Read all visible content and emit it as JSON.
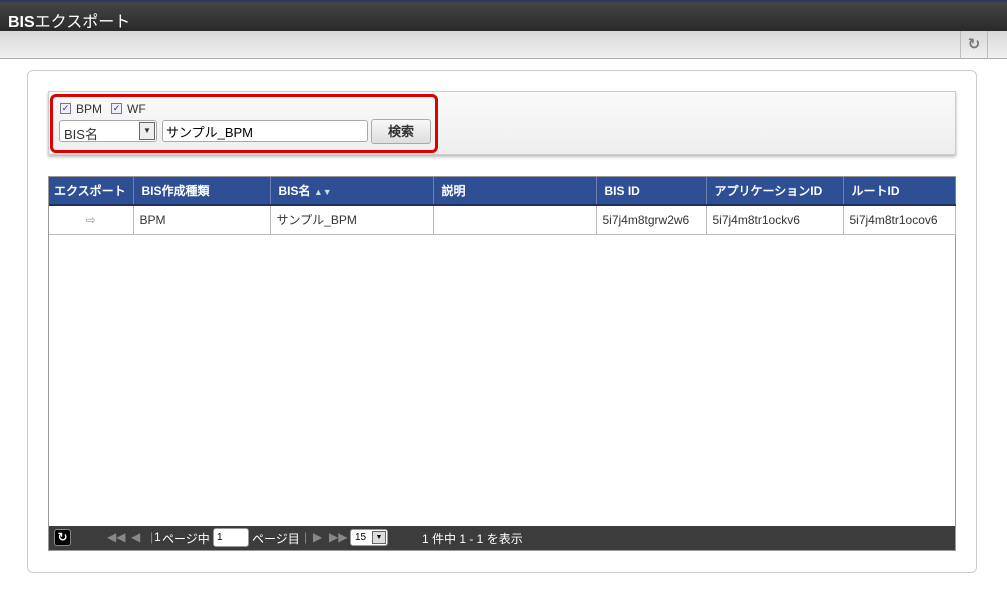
{
  "header": {
    "title_bold": "BIS",
    "title_rest": "エクスポート"
  },
  "search": {
    "checkboxes": [
      {
        "label": "BPM",
        "checked": true
      },
      {
        "label": "WF",
        "checked": true
      }
    ],
    "field_select": "BIS名",
    "keyword": "サンプル_BPM",
    "button": "検索"
  },
  "table": {
    "columns": [
      "エクスポート",
      "BIS作成種類",
      "BIS名",
      "説明",
      "BIS ID",
      "アプリケーションID",
      "ルートID"
    ],
    "rows": [
      {
        "type": "BPM",
        "name": "サンプル_BPM",
        "description": "",
        "bis_id": "5i7j4m8tgrw2w6",
        "app_id": "5i7j4m8tr1ockv6",
        "route_id": "5i7j4m8tr1ocov6"
      }
    ]
  },
  "pager": {
    "total_pages": "1",
    "pages_label": "ページ中",
    "current_page": "1",
    "page_suffix": "ページ目",
    "page_size": "15",
    "summary": "1 件中 1 - 1 を表示"
  }
}
